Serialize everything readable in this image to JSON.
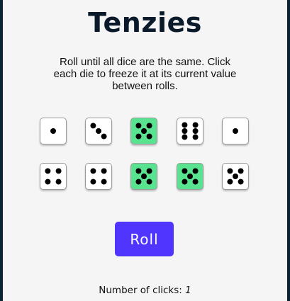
{
  "title": "Tenzies",
  "instructions": "Roll until all dice are the same. Click each die to freeze it at its current value between rolls.",
  "dice": [
    {
      "value": 1,
      "held": false
    },
    {
      "value": 3,
      "held": false
    },
    {
      "value": 5,
      "held": true
    },
    {
      "value": 6,
      "held": false
    },
    {
      "value": 1,
      "held": false
    },
    {
      "value": 4,
      "held": false
    },
    {
      "value": 4,
      "held": false
    },
    {
      "value": 5,
      "held": true
    },
    {
      "value": 5,
      "held": true
    },
    {
      "value": 5,
      "held": false
    }
  ],
  "held_color": "#59e391",
  "button_color": "#5035ff",
  "roll_label": "Roll",
  "clicks_label": "Number of clicks:",
  "clicks_count": "1"
}
